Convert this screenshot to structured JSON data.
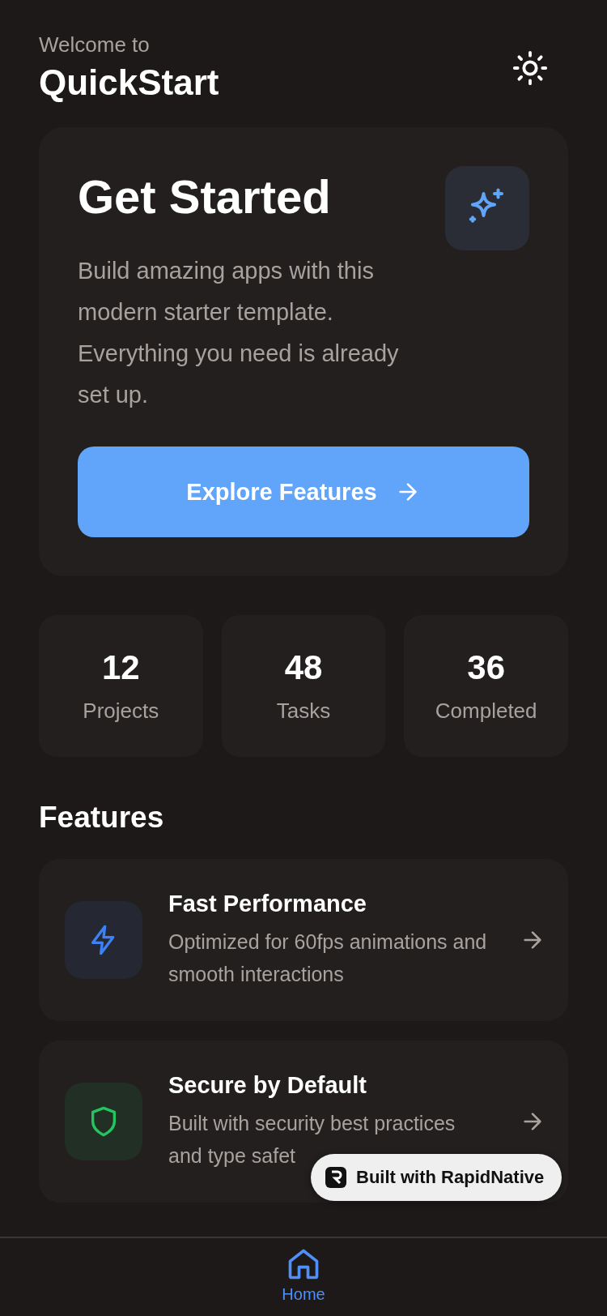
{
  "header": {
    "greeting": "Welcome to",
    "title": "QuickStart"
  },
  "hero": {
    "title": "Get Started",
    "description": "Build amazing apps with this modern starter template. Everything you need is already set up.",
    "button": "Explore Features"
  },
  "stats": [
    {
      "value": "12",
      "label": "Projects"
    },
    {
      "value": "48",
      "label": "Tasks"
    },
    {
      "value": "36",
      "label": "Completed"
    }
  ],
  "features_heading": "Features",
  "features": [
    {
      "kind": "bolt",
      "title": "Fast Performance",
      "description": "Optimized for 60fps animations and smooth interactions",
      "color": "#3b82f6"
    },
    {
      "kind": "shield",
      "title": "Secure by Default",
      "description": "Built with security best practices and type safet",
      "color": "#22c55e"
    }
  ],
  "badge": {
    "label": "Built with RapidNative"
  },
  "tab_bar": [
    {
      "label": "Home",
      "selected": true
    }
  ]
}
